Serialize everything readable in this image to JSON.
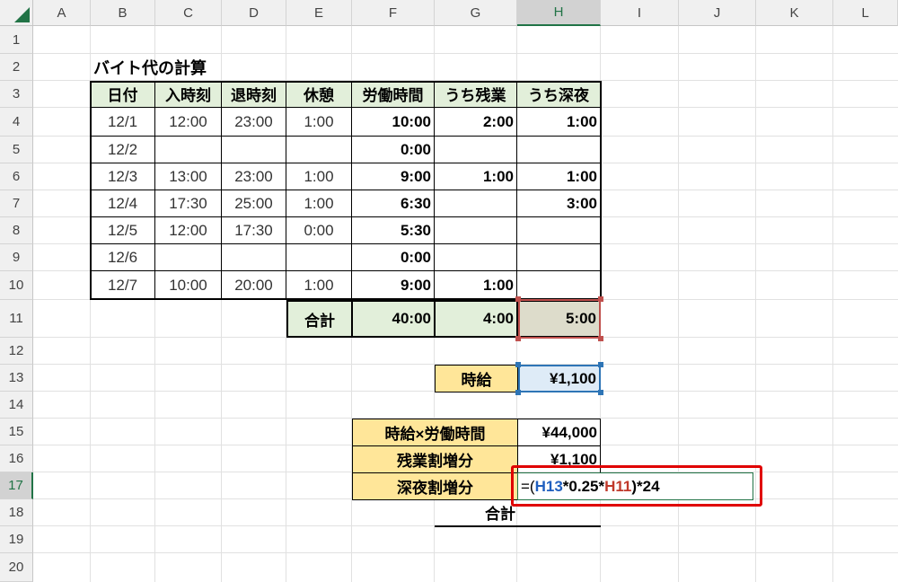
{
  "columns": [
    "A",
    "B",
    "C",
    "D",
    "E",
    "F",
    "G",
    "H",
    "I",
    "J",
    "K",
    "L"
  ],
  "rows": [
    "1",
    "2",
    "3",
    "4",
    "5",
    "6",
    "7",
    "8",
    "9",
    "10",
    "11",
    "12",
    "13",
    "14",
    "15",
    "16",
    "17",
    "18",
    "19",
    "20"
  ],
  "colors": {
    "header_green": "#e2efda",
    "input_yellow": "#ffe699",
    "selected_gray": "#dddccb",
    "rate_blue": "#deebf7",
    "excel_green": "#217346",
    "callout_red": "#e00000"
  },
  "sheet": {
    "title": "バイト代の計算",
    "headers": [
      "日付",
      "入時刻",
      "退時刻",
      "休憩",
      "労働時間",
      "うち残業",
      "うち深夜"
    ],
    "rows": [
      [
        "12/1",
        "12:00",
        "23:00",
        "1:00",
        "10:00",
        "2:00",
        "1:00"
      ],
      [
        "12/2",
        "",
        "",
        "",
        "0:00",
        "",
        ""
      ],
      [
        "12/3",
        "13:00",
        "23:00",
        "1:00",
        "9:00",
        "1:00",
        "1:00"
      ],
      [
        "12/4",
        "17:30",
        "25:00",
        "1:00",
        "6:30",
        "",
        "3:00"
      ],
      [
        "12/5",
        "12:00",
        "17:30",
        "0:00",
        "5:30",
        "",
        ""
      ],
      [
        "12/6",
        "",
        "",
        "",
        "0:00",
        "",
        ""
      ],
      [
        "12/7",
        "10:00",
        "20:00",
        "1:00",
        "9:00",
        "1:00",
        ""
      ]
    ],
    "total_label": "合計",
    "totals": [
      "40:00",
      "4:00",
      "5:00"
    ],
    "rate_label": "時給",
    "rate_value": "¥1,100",
    "summary": [
      {
        "label": "時給×労働時間",
        "value": "¥44,000"
      },
      {
        "label": "残業割増分",
        "value": "¥1,100"
      },
      {
        "label": "深夜割増分",
        "value": ""
      }
    ],
    "grand_total_label": "合計"
  },
  "formula": {
    "prefix": "=(",
    "ref1": "H13",
    "mid": "*0.25*",
    "ref2": "H11",
    "suffix": ")*24"
  }
}
